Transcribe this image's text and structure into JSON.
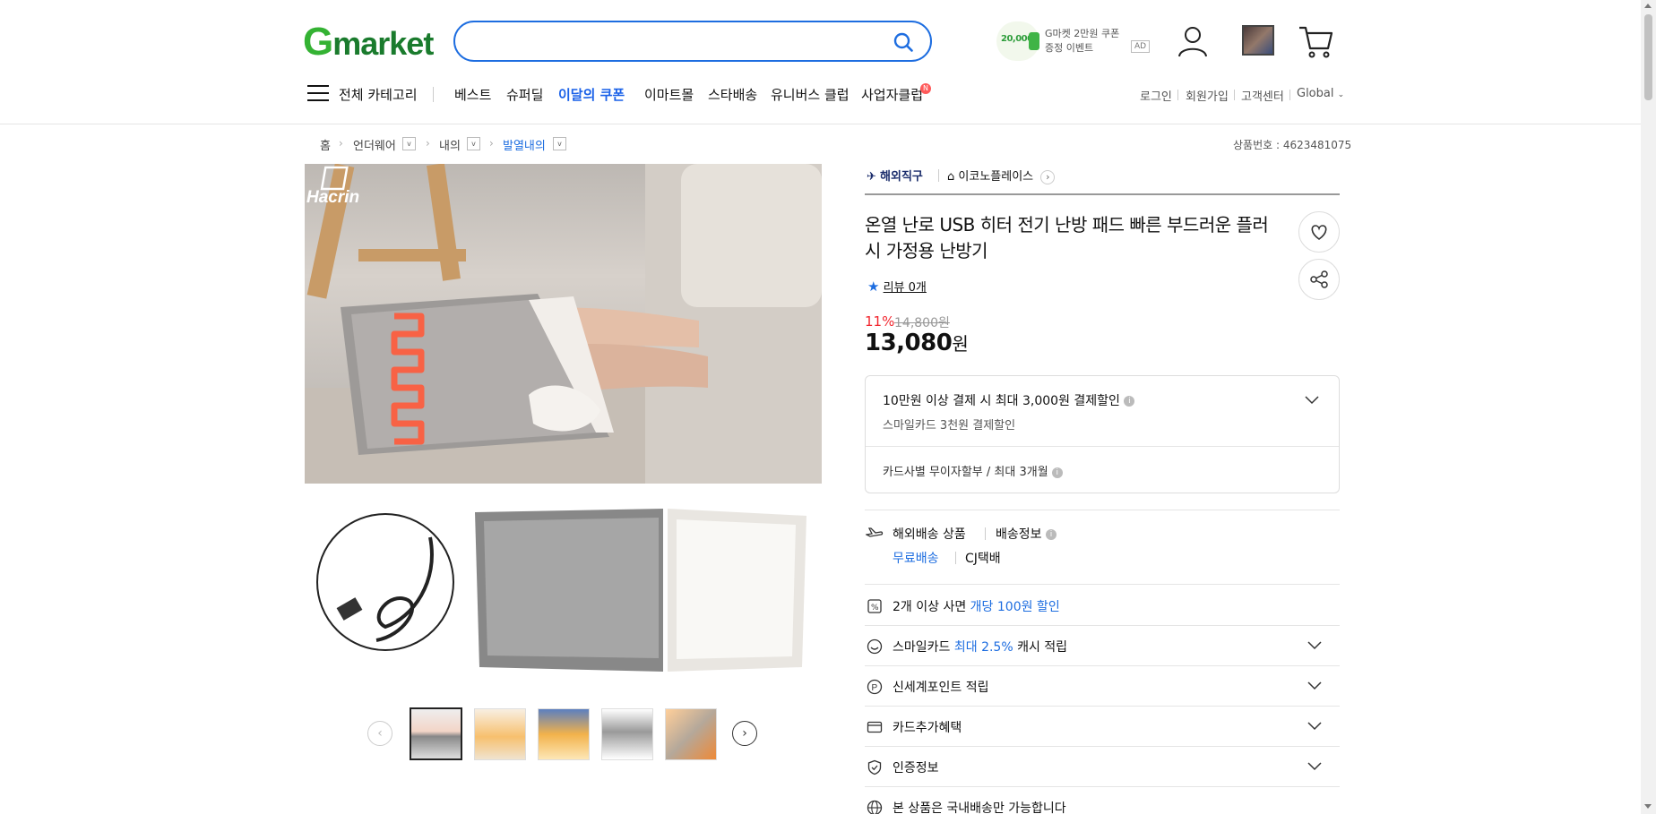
{
  "header": {
    "logo": "Gmarket",
    "search_placeholder": "",
    "promo_coin": "20,000",
    "promo_line1": "G마켓 2만원 쿠폰",
    "promo_line2": "증정 이벤트",
    "ad_label": "AD"
  },
  "nav": {
    "all_categories": "전체 카테고리",
    "items": [
      "베스트",
      "슈퍼딜",
      "이달의 쿠폰",
      "이마트몰",
      "스타배송",
      "유니버스 클럽",
      "사업자클럽"
    ],
    "badge": "N",
    "top_links": [
      "로그인",
      "회원가입",
      "고객센터",
      "Global"
    ]
  },
  "breadcrumb": {
    "home": "홈",
    "level1": "언더웨어",
    "level2": "내의",
    "level3": "발열내의"
  },
  "product": {
    "product_no": "상품번호 : 4623481075",
    "overseas_label": "해외직구",
    "store_name": "이코노플레이스",
    "title": "온열 난로 USB 히터 전기 난방 패드 빠른 부드러운 플러시 가정용 난방기",
    "review": "리뷰 0개",
    "discount": "11%",
    "original_price": "14,800원",
    "price_number": "13,080",
    "price_unit": "원",
    "image_brand": "Hacrin"
  },
  "benefits": {
    "card_discount_title": "10만원 이상 결제 시 최대 3,000원 결제할인",
    "card_discount_sub": "스마일카드 3천원 결제할인",
    "installment": "카드사별 무이자할부 / 최대 3개월"
  },
  "shipping": {
    "type": "해외배송 상품",
    "info": "배송정보",
    "free": "무료배송",
    "courier": "CJ택배"
  },
  "rows": {
    "multi_buy_pre": "2개 이상 사면",
    "multi_buy_hl": "개당 100원 할인",
    "smile_pre": "스마일카드",
    "smile_hl": "최대 2.5%",
    "smile_post": "캐시 적립",
    "point": "신세계포인트 적립",
    "card_extra": "카드추가혜택",
    "cert": "인증정보",
    "domestic": "본 상품은 국내배송만 가능합니다"
  }
}
